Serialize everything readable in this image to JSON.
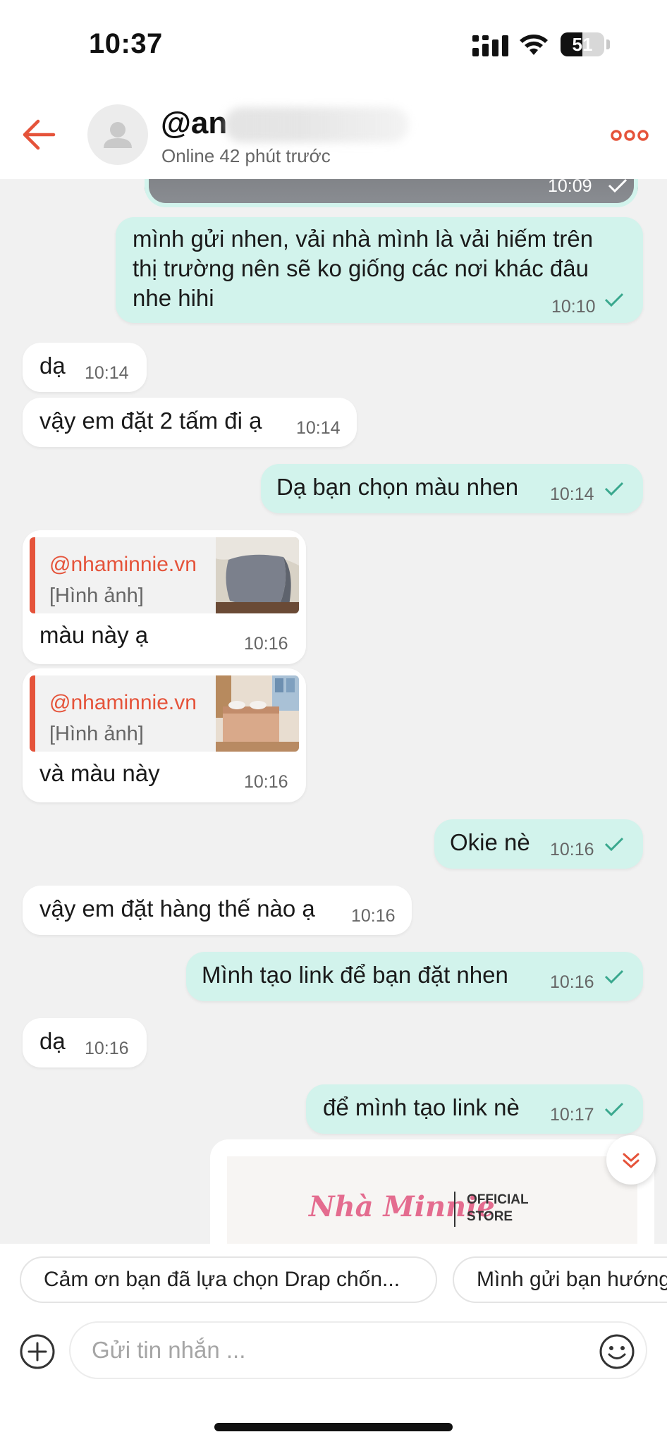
{
  "status_bar": {
    "time": "10:37",
    "battery": "51",
    "icons": [
      "signal-icon",
      "wifi-icon",
      "battery-icon"
    ]
  },
  "header": {
    "back_icon": "arrow-left-icon",
    "contact_name": "@an",
    "contact_status": "Online 42 phút trước",
    "more_icon": "more-dots-icon",
    "accent_color": "#e5533a"
  },
  "messages": [
    {
      "dir": "out",
      "kind": "image",
      "time": "10:09"
    },
    {
      "dir": "out",
      "lines": [
        "mình gửi nhen, vải nhà mình là vải hiếm trên",
        "thị trường nên sẽ ko giống các nơi khác đâu",
        "nhe hihi"
      ],
      "time": "10:10"
    },
    {
      "dir": "in",
      "text": "dạ",
      "time": "10:14"
    },
    {
      "dir": "in",
      "text": "vậy em đặt 2 tấm đi ạ",
      "time": "10:14"
    },
    {
      "dir": "out",
      "text": "Dạ bạn chọn màu nhen",
      "time": "10:14"
    },
    {
      "dir": "in",
      "quote_user": "@nhaminnie.vn",
      "quote_type": "[Hình ảnh]",
      "text": "màu này ạ",
      "time": "10:16"
    },
    {
      "dir": "in",
      "quote_user": "@nhaminnie.vn",
      "quote_type": "[Hình ảnh]",
      "text": "và màu này",
      "time": "10:16"
    },
    {
      "dir": "out",
      "text": "Okie nè",
      "time": "10:16"
    },
    {
      "dir": "in",
      "text": "vậy em đặt hàng thế nào ạ",
      "time": "10:16"
    },
    {
      "dir": "out",
      "text": "Mình tạo link để bạn đặt nhen",
      "time": "10:16"
    },
    {
      "dir": "in",
      "text": "dạ",
      "time": "10:16"
    },
    {
      "dir": "out",
      "text": "để mình tạo link nè",
      "time": "10:17"
    }
  ],
  "product_card": {
    "brand": "Nhà Minnie",
    "official_line1": "OFFICIAL",
    "official_line2": "STORE"
  },
  "quick_replies": [
    "Cảm ơn bạn đã lựa chọn Drap chốn...",
    "Mình gửi bạn hướng"
  ],
  "composer": {
    "placeholder": "Gửi tin nhắn ...",
    "add_icon": "plus-circle-icon",
    "emoji_icon": "emoji-icon"
  },
  "colors": {
    "outgoing_bubble": "#d2f3ec",
    "incoming_bubble": "#ffffff",
    "check": "#3aa88e",
    "background": "#f1f1f1"
  }
}
